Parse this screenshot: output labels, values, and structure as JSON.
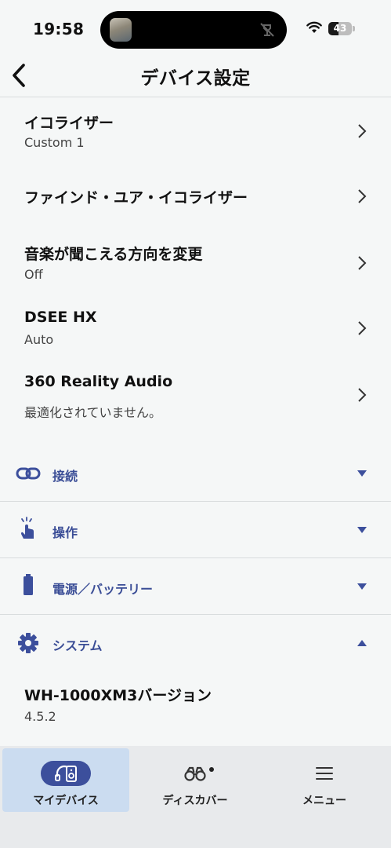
{
  "status_bar": {
    "time": "19:58",
    "battery": "43",
    "battery_level": 0.43
  },
  "header": {
    "title": "デバイス設定"
  },
  "settings": [
    {
      "title": "イコライザー",
      "subtitle": "Custom 1"
    },
    {
      "title": "ファインド・ユア・イコライザー",
      "subtitle": ""
    },
    {
      "title": "音楽が聞こえる方向を変更",
      "subtitle": "Off"
    },
    {
      "title": "DSEE HX",
      "subtitle": "Auto"
    },
    {
      "title": "360 Reality Audio",
      "subtitle": "最適化されていません。"
    }
  ],
  "sections": [
    {
      "label": "接続",
      "icon": "link-icon",
      "expanded": false
    },
    {
      "label": "操作",
      "icon": "touch-icon",
      "expanded": false
    },
    {
      "label": "電源／バッテリー",
      "icon": "battery-icon",
      "expanded": false
    },
    {
      "label": "システム",
      "icon": "gear-icon",
      "expanded": true
    }
  ],
  "system": {
    "version_title": "WH-1000XM3バージョン",
    "version_value": "4.5.2"
  },
  "tab_bar": {
    "tabs": [
      {
        "label": "マイデバイス",
        "icon": "headphones-icon",
        "active": true
      },
      {
        "label": "ディスカバー",
        "icon": "binoculars-icon",
        "active": false
      },
      {
        "label": "メニュー",
        "icon": "menu-icon",
        "active": false
      }
    ]
  },
  "colors": {
    "accent": "#3c4f9c",
    "active_tab_bg": "#cbdcf0",
    "background": "#f5f7f7"
  }
}
